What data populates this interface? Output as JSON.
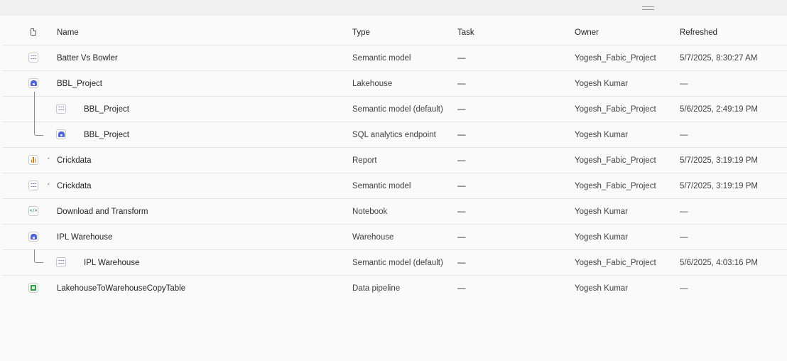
{
  "columns": {
    "name": "Name",
    "type": "Type",
    "task": "Task",
    "owner": "Owner",
    "refreshed": "Refreshed"
  },
  "rows": [
    {
      "name": "Batter Vs Bowler",
      "type": "Semantic model",
      "task": "—",
      "owner": "Yogesh_Fabic_Project",
      "refreshed": "5/7/2025, 8:30:27 AM",
      "icon": "semantic-model-icon"
    },
    {
      "name": "BBL_Project",
      "type": "Lakehouse",
      "task": "—",
      "owner": "Yogesh Kumar",
      "refreshed": "—",
      "icon": "lakehouse-icon"
    },
    {
      "name": "BBL_Project",
      "type": "Semantic model (default)",
      "task": "—",
      "owner": "Yogesh_Fabic_Project",
      "refreshed": "5/6/2025, 2:49:19 PM",
      "icon": "semantic-model-icon"
    },
    {
      "name": "BBL_Project",
      "type": "SQL analytics endpoint",
      "task": "—",
      "owner": "Yogesh Kumar",
      "refreshed": "—",
      "icon": "sql-endpoint-icon"
    },
    {
      "name": "Crickdata",
      "type": "Report",
      "task": "—",
      "owner": "Yogesh_Fabic_Project",
      "refreshed": "5/7/2025, 3:19:19 PM",
      "icon": "report-icon"
    },
    {
      "name": "Crickdata",
      "type": "Semantic model",
      "task": "—",
      "owner": "Yogesh_Fabic_Project",
      "refreshed": "5/7/2025, 3:19:19 PM",
      "icon": "semantic-model-icon"
    },
    {
      "name": "Download and Transform",
      "type": "Notebook",
      "task": "—",
      "owner": "Yogesh Kumar",
      "refreshed": "—",
      "icon": "notebook-icon"
    },
    {
      "name": "IPL Warehouse",
      "type": "Warehouse",
      "task": "—",
      "owner": "Yogesh Kumar",
      "refreshed": "—",
      "icon": "warehouse-icon"
    },
    {
      "name": "IPL Warehouse",
      "type": "Semantic model (default)",
      "task": "—",
      "owner": "Yogesh_Fabic_Project",
      "refreshed": "5/6/2025, 4:03:16 PM",
      "icon": "semantic-model-icon"
    },
    {
      "name": "LakehouseToWarehouseCopyTable",
      "type": "Data pipeline",
      "task": "—",
      "owner": "Yogesh Kumar",
      "refreshed": "—",
      "icon": "pipeline-icon"
    }
  ],
  "shortcut_glyph": "⸗"
}
